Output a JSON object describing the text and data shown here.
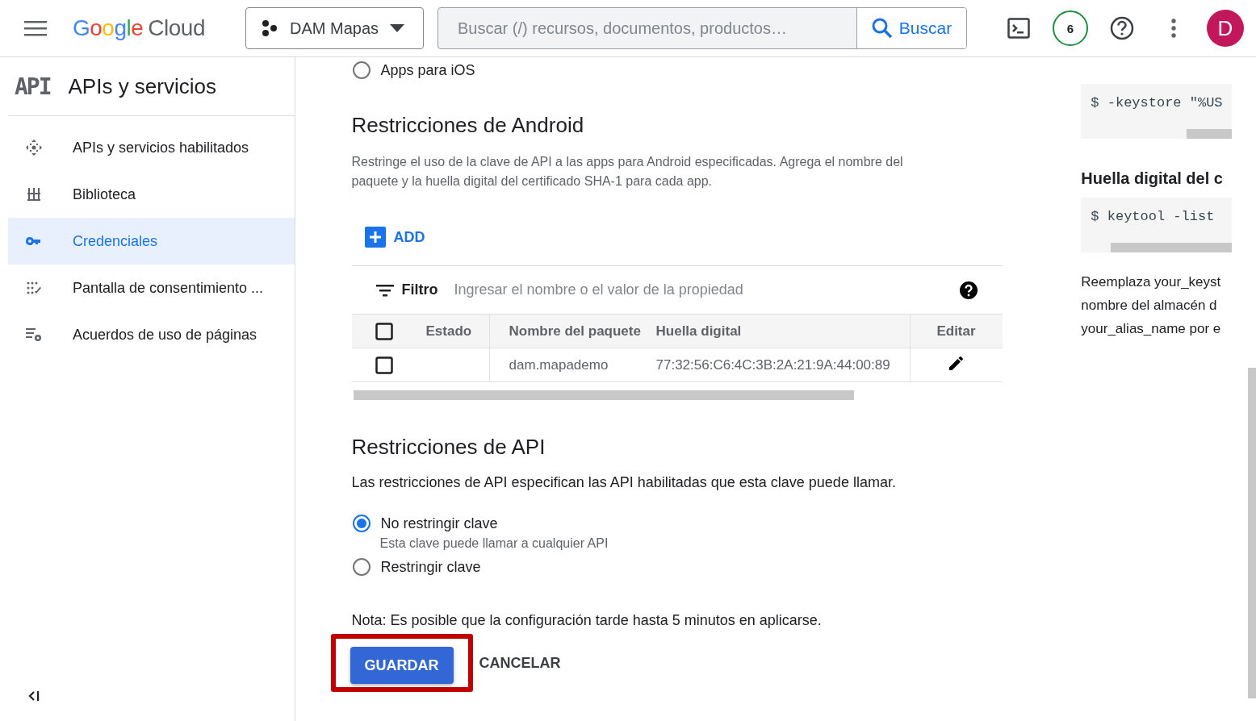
{
  "header": {
    "logo": {
      "brand": "Google",
      "product": "Cloud"
    },
    "project": "DAM Mapas",
    "search": {
      "placeholder": "Buscar (/) recursos, documentos, productos…",
      "button": "Buscar"
    },
    "notifications": "6",
    "avatar": "D"
  },
  "sidebar": {
    "badge": "API",
    "title": "APIs y servicios",
    "items": [
      {
        "label": "APIs y servicios habilitados",
        "kind": "dashboard",
        "selected": false
      },
      {
        "label": "Biblioteca",
        "kind": "library",
        "selected": false
      },
      {
        "label": "Credenciales",
        "kind": "key",
        "selected": true
      },
      {
        "label": "Pantalla de consentimiento ...",
        "kind": "consent",
        "selected": false
      },
      {
        "label": "Acuerdos de uso de páginas",
        "kind": "agreements",
        "selected": false
      }
    ]
  },
  "app_option": {
    "label": "Apps para iOS",
    "selected": false
  },
  "android": {
    "title": "Restricciones de Android",
    "description": "Restringe el uso de la clave de API a las apps para Android especificadas. Agrega el nombre del paquete y la huella digital del certificado SHA-1 para cada app.",
    "add": "ADD",
    "filter": {
      "label": "Filtro",
      "placeholder": "Ingresar el nombre o el valor de la propiedad"
    },
    "table": {
      "header_checked": false,
      "columns": [
        "Estado",
        "Nombre del paquete",
        "Huella digital",
        "Editar"
      ],
      "rows": [
        {
          "checked": false,
          "package": "dam.mapademo",
          "fingerprint": "77:32:56:C6:4C:3B:2A:21:9A:44:00:89"
        }
      ]
    }
  },
  "api": {
    "title": "Restricciones de API",
    "description": "Las restricciones de API especifican las API habilitadas que esta clave puede llamar.",
    "options": [
      {
        "label": "No restringir clave",
        "hint": "Esta clave puede llamar a cualquier API",
        "selected": true
      },
      {
        "label": "Restringir clave",
        "selected": false
      }
    ],
    "note": "Nota: Es posible que la configuración tarde hasta 5 minutos en aplicarse.",
    "save": "GUARDAR",
    "cancel": "CANCELAR"
  },
  "side_panel": {
    "code_1": "$ -keystore \"%US",
    "heading": "Huella digital del c",
    "code_2": "$  keytool -list",
    "paragraph": [
      "Reemplaza your_keyst",
      "nombre del almacén d",
      "your_alias_name por e"
    ]
  }
}
